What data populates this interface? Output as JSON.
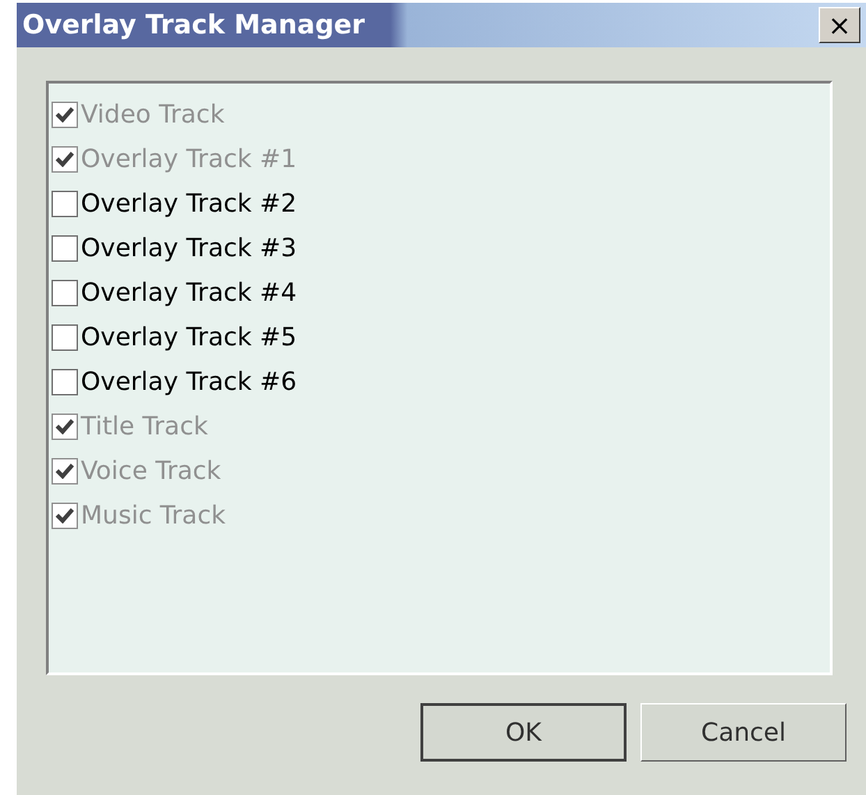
{
  "window": {
    "title": "Overlay Track Manager",
    "close": "×"
  },
  "tracks": [
    {
      "label": "Video Track",
      "checked": true,
      "disabled": true
    },
    {
      "label": "Overlay Track #1",
      "checked": true,
      "disabled": true
    },
    {
      "label": "Overlay Track #2",
      "checked": false,
      "disabled": false
    },
    {
      "label": "Overlay Track #3",
      "checked": false,
      "disabled": false
    },
    {
      "label": "Overlay Track #4",
      "checked": false,
      "disabled": false
    },
    {
      "label": "Overlay Track #5",
      "checked": false,
      "disabled": false
    },
    {
      "label": "Overlay Track #6",
      "checked": false,
      "disabled": false
    },
    {
      "label": "Title Track",
      "checked": true,
      "disabled": true
    },
    {
      "label": "Voice Track",
      "checked": true,
      "disabled": true
    },
    {
      "label": "Music Track",
      "checked": true,
      "disabled": true
    }
  ],
  "buttons": [
    {
      "label": "OK",
      "default": true
    },
    {
      "label": "Cancel",
      "default": false
    }
  ]
}
